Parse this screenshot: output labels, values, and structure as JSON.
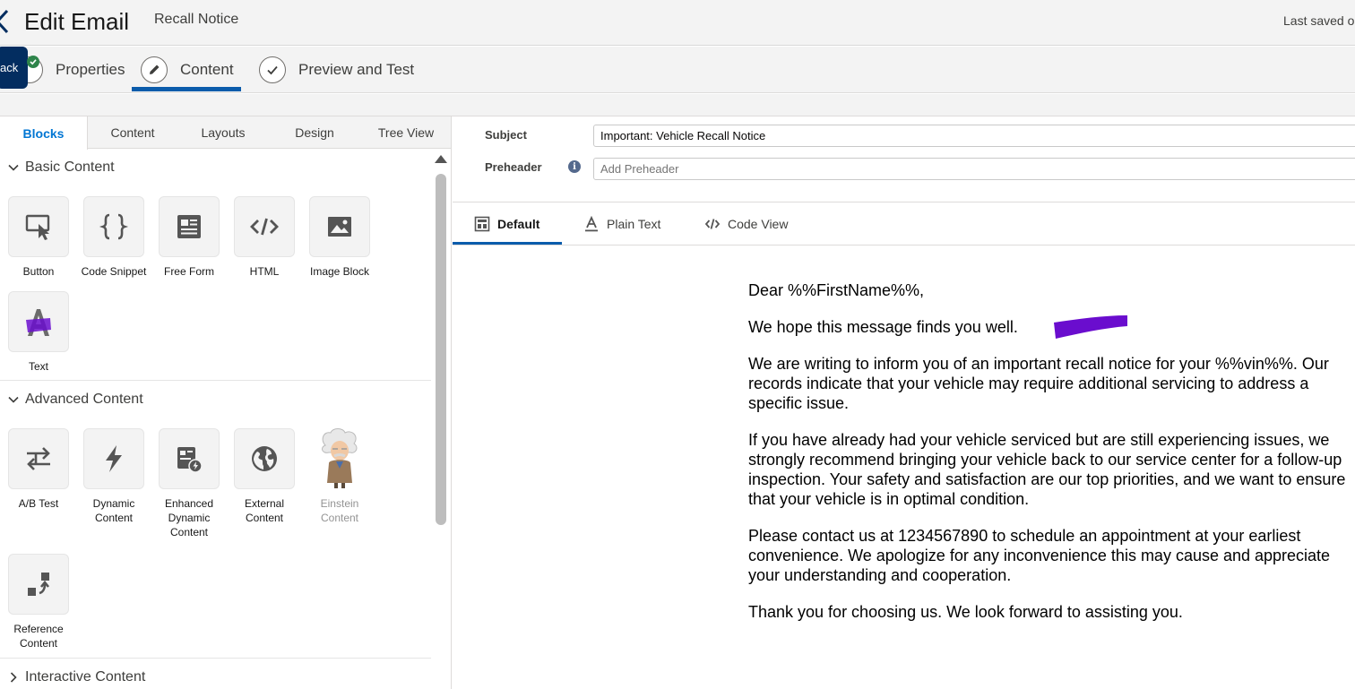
{
  "header": {
    "title": "Edit Email",
    "email_name": "Recall Notice",
    "last_saved": "Last saved o",
    "back_tooltip": "ack"
  },
  "steps": [
    {
      "label": "Properties",
      "icon": "check-circle-icon"
    },
    {
      "label": "Content",
      "icon": "pencil-icon"
    },
    {
      "label": "Preview and Test",
      "icon": "checkmark-icon"
    }
  ],
  "left_tabs": [
    "Blocks",
    "Content",
    "Layouts",
    "Design",
    "Tree View"
  ],
  "sections": {
    "basic": {
      "title": "Basic Content",
      "blocks": [
        {
          "label": "Button",
          "icon": "button-click-icon"
        },
        {
          "label": "Code Snippet",
          "icon": "curly-braces-icon"
        },
        {
          "label": "Free Form",
          "icon": "free-form-icon"
        },
        {
          "label": "HTML",
          "icon": "code-icon"
        },
        {
          "label": "Image Block",
          "icon": "image-icon"
        },
        {
          "label": "Text",
          "icon": "text-a-icon"
        }
      ]
    },
    "advanced": {
      "title": "Advanced Content",
      "blocks": [
        {
          "label": "A/B Test",
          "icon": "ab-test-icon"
        },
        {
          "label": "Dynamic Content",
          "icon": "lightning-icon"
        },
        {
          "label": "Enhanced Dynamic Content",
          "icon": "enhanced-dynamic-icon"
        },
        {
          "label": "External Content",
          "icon": "globe-icon"
        },
        {
          "label": "Einstein Content",
          "icon": "einstein-icon"
        },
        {
          "label": "Reference Content",
          "icon": "reference-icon"
        }
      ]
    },
    "interactive": {
      "title": "Interactive Content"
    }
  },
  "fields": {
    "subject_label": "Subject",
    "subject_value": "Important: Vehicle Recall Notice",
    "preheader_label": "Preheader",
    "preheader_placeholder": "Add Preheader"
  },
  "view_tabs": [
    {
      "label": "Default",
      "icon": "layout-icon"
    },
    {
      "label": "Plain Text",
      "icon": "text-a-underline-icon"
    },
    {
      "label": "Code View",
      "icon": "code-icon"
    }
  ],
  "email": {
    "greeting": "Dear %%FirstName%%,",
    "p1": "We hope this message finds you well.",
    "p2": "We are writing to inform you of an important recall notice for your %%vin%%. Our records indicate that your vehicle may require additional servicing to address a specific issue.",
    "p3": "If you have already had your vehicle serviced but are still experiencing issues, we strongly recommend bringing your vehicle back to our service center for a follow-up inspection. Your safety and satisfaction are our top priorities, and we want to ensure that your vehicle is in optimal condition.",
    "p4": "Please contact us at 1234567890 to schedule an appointment at your earliest convenience. We apologize for any inconvenience this may cause and appreciate your understanding and cooperation.",
    "p5": "Thank you for choosing us. We look forward to assisting you."
  },
  "colors": {
    "accent": "#0b5cab",
    "tab_active": "#0176d3",
    "tooltip": "#032d60",
    "scribble": "#6a0dce"
  }
}
